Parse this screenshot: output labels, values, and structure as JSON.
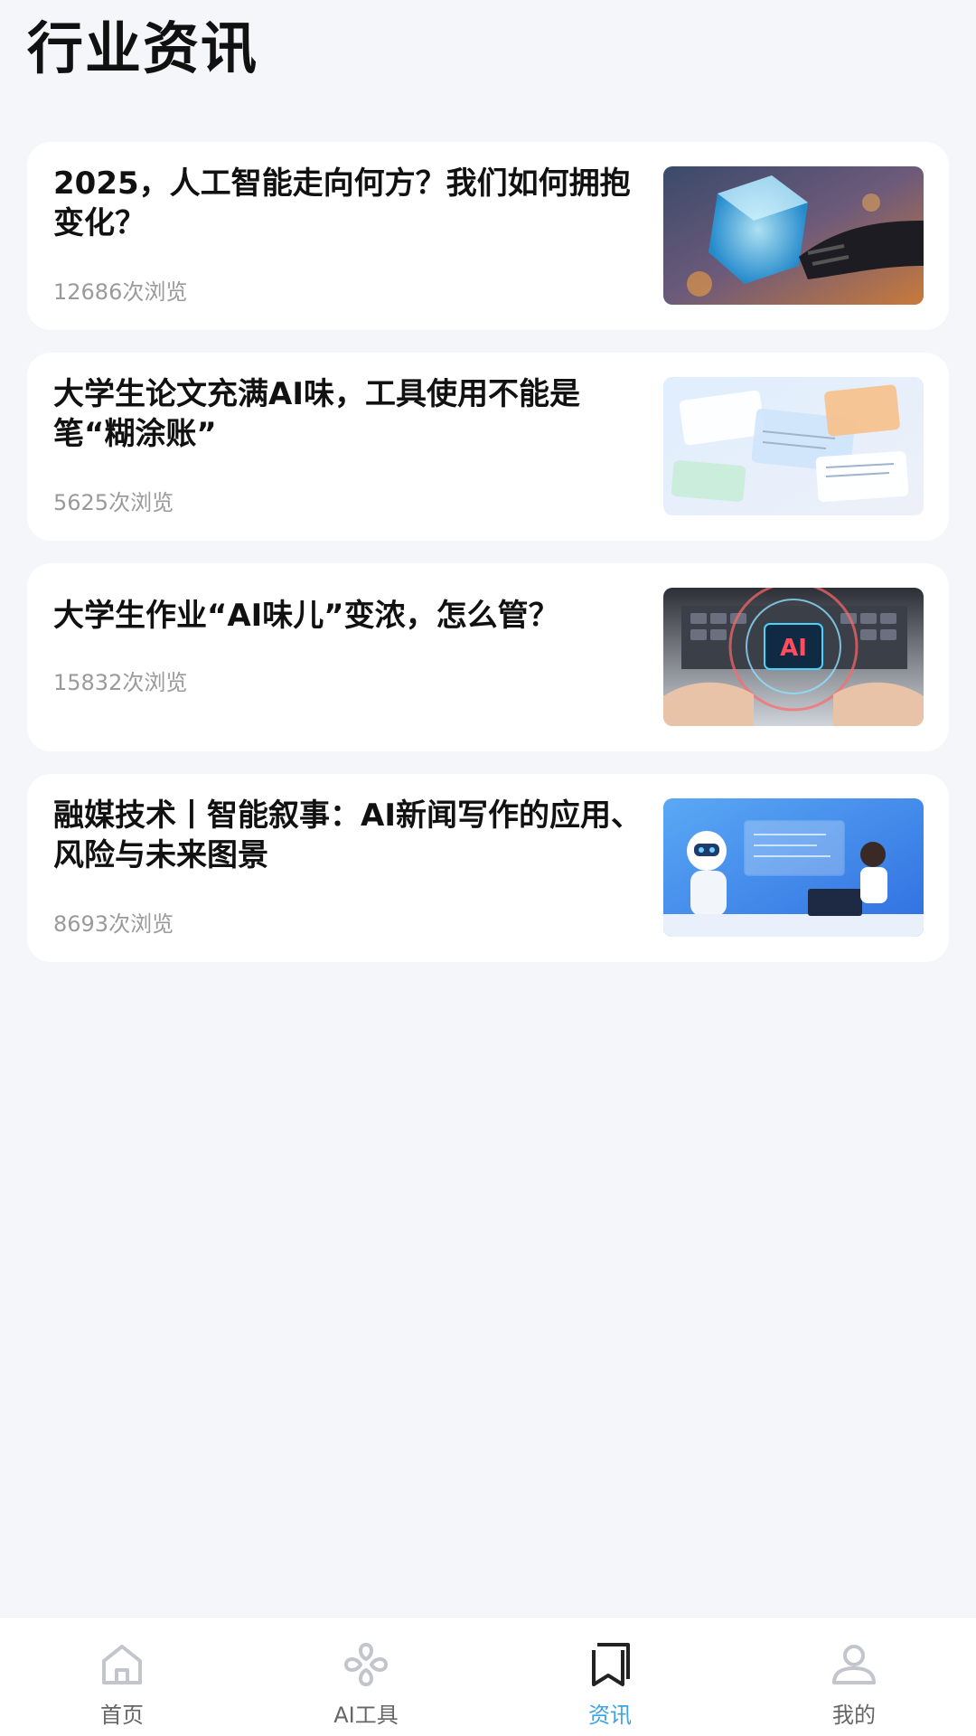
{
  "page": {
    "title": "行业资讯"
  },
  "articles": [
    {
      "title": "2025，人工智能走向何方？我们如何拥抱变化？",
      "views": "12686次浏览",
      "image": "ai-cube-robot-hand-image"
    },
    {
      "title": "大学生论文充满AI味，工具使用不能是笔“糊涂账”",
      "views": "5625次浏览",
      "image": "floating-documents-image"
    },
    {
      "title": "大学生作业“AI味儿”变浓，怎么管？",
      "views": "15832次浏览",
      "image": "ai-keyboard-hands-image"
    },
    {
      "title": "融媒技术丨智能叙事：AI新闻写作的应用、风险与未来图景",
      "views": "8693次浏览",
      "image": "robot-and-woman-laptop-image"
    }
  ],
  "tabbar": {
    "active_color": "#3aa3e6",
    "inactive_color": "#666666",
    "tabs": [
      {
        "label": "首页",
        "icon": "home-icon"
      },
      {
        "label": "AI工具",
        "icon": "ai-tools-icon"
      },
      {
        "label": "资讯",
        "icon": "news-bookmark-icon"
      },
      {
        "label": "我的",
        "icon": "profile-icon"
      }
    ]
  }
}
